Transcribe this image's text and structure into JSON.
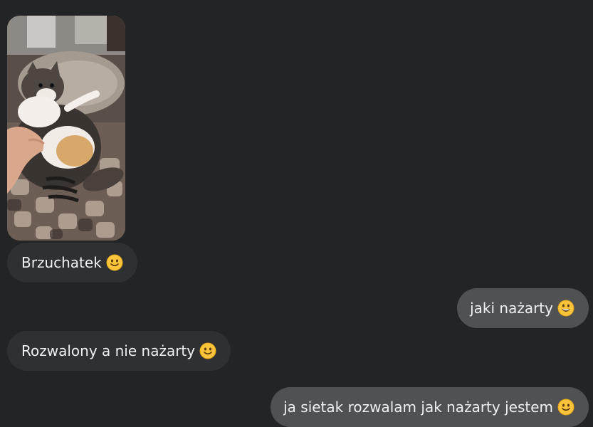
{
  "chat": {
    "messages": [
      {
        "id": "m1",
        "direction": "incoming",
        "kind": "image",
        "content": "cat photo"
      },
      {
        "id": "m2",
        "direction": "incoming",
        "text": "Brzuchatek",
        "emoji": "slightly-smiling-face"
      },
      {
        "id": "m3",
        "direction": "outgoing",
        "text": "jaki nażarty",
        "emoji": "grinning-face"
      },
      {
        "id": "m4",
        "direction": "incoming",
        "text": "Rozwalony a nie nażarty",
        "emoji": "slightly-smiling-face"
      },
      {
        "id": "m5",
        "direction": "outgoing",
        "text": "ja sietak rozwalam jak nażarty jestem",
        "emoji": "slightly-smiling-face"
      }
    ]
  },
  "colors": {
    "background": "#232426",
    "incoming_bubble": "#2e3033",
    "outgoing_bubble": "#505153",
    "text": "#eef0f2"
  }
}
